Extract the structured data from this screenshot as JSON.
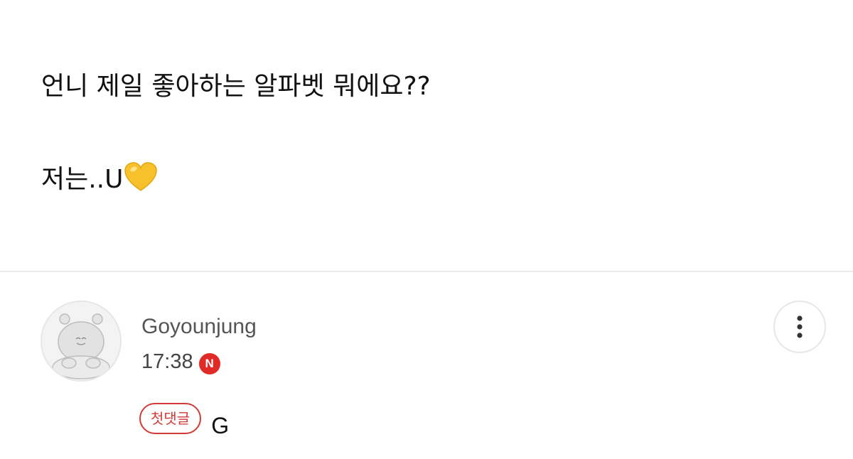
{
  "post": {
    "line1": "언니 제일 좋아하는 알파벳 뭐에요??",
    "line2": "저는..U",
    "line2_emoji": "yellow-heart-icon"
  },
  "comment": {
    "author": "Goyounjung",
    "time": "17:38",
    "new_badge": "N",
    "first_comment_badge": "첫댓글",
    "text": "G",
    "avatar_icon": "bear-character-avatar",
    "more_icon": "vertical-ellipsis-icon"
  },
  "colors": {
    "badge_red": "#e02a27",
    "first_comment_red": "#d23b36",
    "heart_yellow": "#f7c12b",
    "divider": "#ececec"
  }
}
